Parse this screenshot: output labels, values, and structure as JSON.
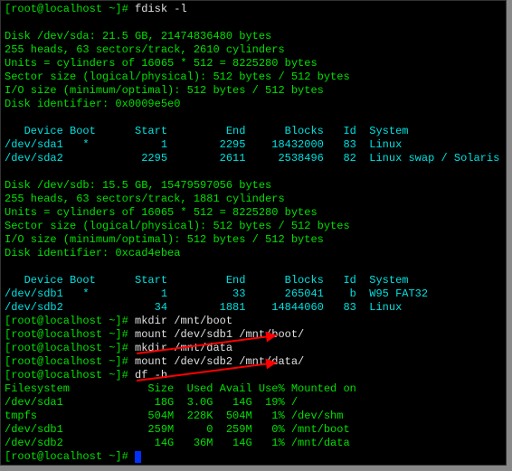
{
  "prompt": "[root@localhost ~]# ",
  "cmd_fdisk": "fdisk -l",
  "sda": {
    "hdr": "Disk /dev/sda: 21.5 GB, 21474836480 bytes",
    "geom": "255 heads, 63 sectors/track, 2610 cylinders",
    "units": "Units = cylinders of 16065 * 512 = 8225280 bytes",
    "ss": "Sector size (logical/physical): 512 bytes / 512 bytes",
    "io": "I/O size (minimum/optimal): 512 bytes / 512 bytes",
    "id": "Disk identifier: 0x0009e5e0"
  },
  "ptbl_hdr": "   Device Boot      Start         End      Blocks   Id  System",
  "sda1": "/dev/sda1   *           1        2295    18432000   83  Linux",
  "sda2": "/dev/sda2            2295        2611     2538496   82  Linux swap / Solaris",
  "sdb": {
    "hdr": "Disk /dev/sdb: 15.5 GB, 15479597056 bytes",
    "geom": "255 heads, 63 sectors/track, 1881 cylinders",
    "units": "Units = cylinders of 16065 * 512 = 8225280 bytes",
    "ss": "Sector size (logical/physical): 512 bytes / 512 bytes",
    "io": "I/O size (minimum/optimal): 512 bytes / 512 bytes",
    "id": "Disk identifier: 0xcad4ebea"
  },
  "sdb1": "/dev/sdb1   *           1          33      265041    b  W95 FAT32",
  "sdb2": "/dev/sdb2              34        1881    14844060   83  Linux",
  "cmd_mkdir_boot": "mkdir /mnt/boot",
  "cmd_mount_boot": "mount /dev/sdb1 /mnt/boot/",
  "cmd_mkdir_data": "mkdir /mnt/data",
  "cmd_mount_data": "mount /dev/sdb2 /mnt/data/",
  "cmd_df": "df -h",
  "df_hdr": "Filesystem            Size  Used Avail Use% Mounted on",
  "df_sda1": "/dev/sda1              18G  3.0G   14G  19% /",
  "df_tmpfs": "tmpfs                 504M  228K  504M   1% /dev/shm",
  "df_sdb1": "/dev/sdb1             259M     0  259M   0% /mnt/boot",
  "df_sdb2": "/dev/sdb2              14G   36M   14G   1% /mnt/data"
}
